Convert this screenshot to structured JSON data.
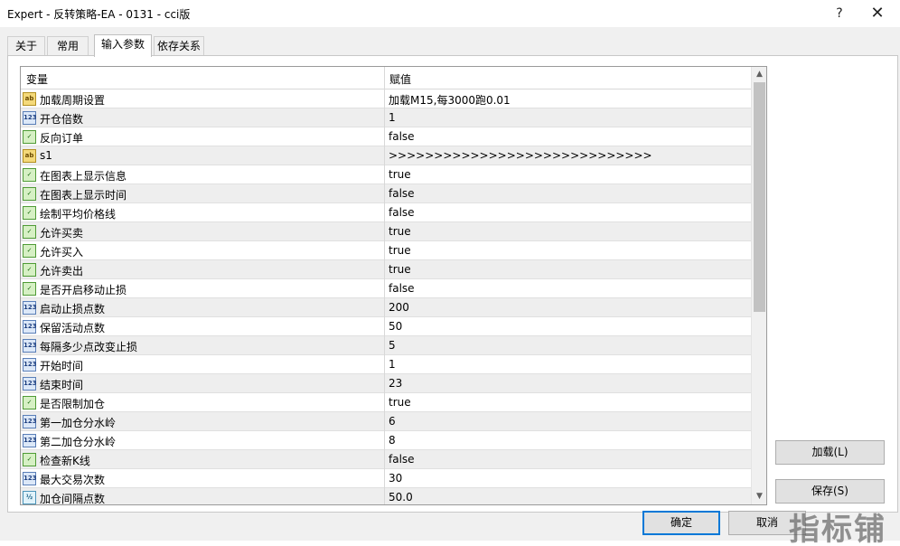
{
  "window": {
    "title": "Expert - 反转策略-EA - 0131 - cci版",
    "help_glyph": "?",
    "close_glyph": "✕"
  },
  "tabs": [
    {
      "label": "关于"
    },
    {
      "label": "常用"
    },
    {
      "label": "输入参数",
      "active": true
    },
    {
      "label": "依存关系"
    }
  ],
  "table": {
    "col_variable": "变量",
    "col_value": "赋值",
    "rows": [
      {
        "type": "string",
        "icon_text": "ab",
        "name": "加载周期设置",
        "value": "加载M15,每3000跑0.01"
      },
      {
        "type": "int",
        "icon_text": "123",
        "name": "开仓倍数",
        "value": "1"
      },
      {
        "type": "bool",
        "icon_text": "✓",
        "name": "反向订单",
        "value": "false"
      },
      {
        "type": "string",
        "icon_text": "ab",
        "name": "s1",
        "value": ">>>>>>>>>>>>>>>>>>>>>>>>>>>>>"
      },
      {
        "type": "bool",
        "icon_text": "✓",
        "name": "在图表上显示信息",
        "value": "true"
      },
      {
        "type": "bool",
        "icon_text": "✓",
        "name": "在图表上显示时间",
        "value": "false"
      },
      {
        "type": "bool",
        "icon_text": "✓",
        "name": "绘制平均价格线",
        "value": "false"
      },
      {
        "type": "bool",
        "icon_text": "✓",
        "name": "允许买卖",
        "value": "true"
      },
      {
        "type": "bool",
        "icon_text": "✓",
        "name": "允许买入",
        "value": "true"
      },
      {
        "type": "bool",
        "icon_text": "✓",
        "name": "允许卖出",
        "value": "true"
      },
      {
        "type": "bool",
        "icon_text": "✓",
        "name": "是否开启移动止损",
        "value": "false"
      },
      {
        "type": "int",
        "icon_text": "123",
        "name": "启动止损点数",
        "value": "200"
      },
      {
        "type": "int",
        "icon_text": "123",
        "name": "保留活动点数",
        "value": "50"
      },
      {
        "type": "int",
        "icon_text": "123",
        "name": "每隔多少点改变止损",
        "value": "5"
      },
      {
        "type": "int",
        "icon_text": "123",
        "name": "开始时间",
        "value": "1"
      },
      {
        "type": "int",
        "icon_text": "123",
        "name": "结束时间",
        "value": "23"
      },
      {
        "type": "bool",
        "icon_text": "✓",
        "name": "是否限制加仓",
        "value": "true"
      },
      {
        "type": "int",
        "icon_text": "123",
        "name": "第一加仓分水岭",
        "value": "6"
      },
      {
        "type": "int",
        "icon_text": "123",
        "name": "第二加仓分水岭",
        "value": "8"
      },
      {
        "type": "bool",
        "icon_text": "✓",
        "name": "检查新K线",
        "value": "false"
      },
      {
        "type": "int",
        "icon_text": "123",
        "name": "最大交易次数",
        "value": "30"
      },
      {
        "type": "double",
        "icon_text": "½",
        "name": "加仓间隔点数",
        "value": "50.0"
      }
    ]
  },
  "buttons": {
    "load": "加载(L)",
    "save": "保存(S)",
    "ok": "确定",
    "cancel": "取消"
  },
  "watermark": "指标铺",
  "colors": {
    "default_button_border": "#0078d7",
    "row_alt": "#eeeeee",
    "scroll_thumb": "#c2c2c2"
  }
}
